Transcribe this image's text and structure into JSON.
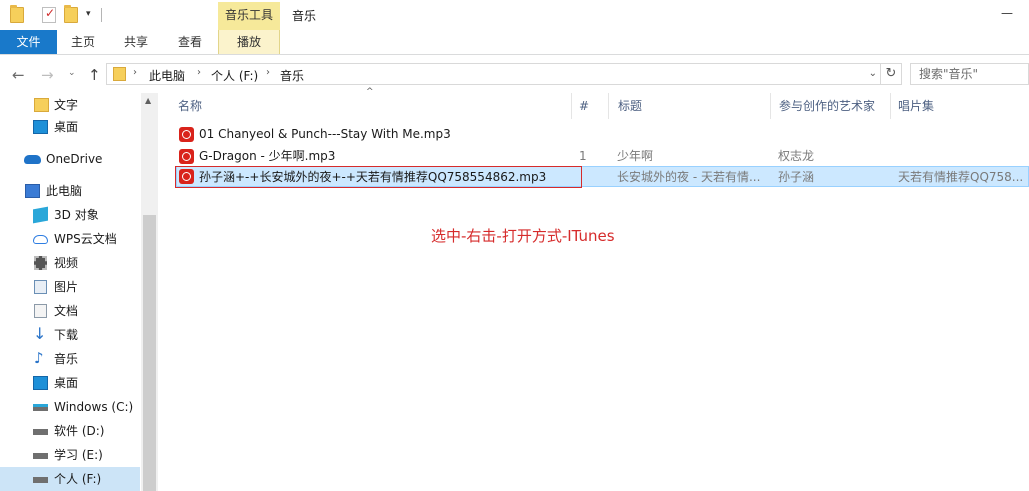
{
  "window": {
    "context_tab_group": "音乐工具",
    "title": "音乐",
    "minimize_glyph": "—"
  },
  "ribbon": {
    "tabs": [
      "文件",
      "主页",
      "共享",
      "查看",
      "播放"
    ]
  },
  "nav": {
    "back_glyph": "←",
    "forward_glyph": "→",
    "recent_glyph": "⌄",
    "up_glyph": "↑",
    "breadcrumb": [
      "此电脑",
      "个人 (F:)",
      "音乐"
    ],
    "crumb_sep": "›",
    "address_dropdown_glyph": "⌄",
    "refresh_glyph": "↻",
    "search_placeholder": "搜索\"音乐\""
  },
  "sidebar": {
    "items": [
      {
        "label": "文字",
        "icon": "folder-icon",
        "color": "#f6cf5b"
      },
      {
        "label": "桌面",
        "icon": "desktop-icon",
        "color": "#1e90d8"
      },
      {
        "label": "OneDrive",
        "icon": "onedrive-icon",
        "color": "#1f73c8"
      },
      {
        "label": "此电脑",
        "icon": "computer-icon",
        "color": "#3a7bd5"
      },
      {
        "label": "3D 对象",
        "icon": "3d-objects-icon",
        "color": "#2aa7d9"
      },
      {
        "label": "WPS云文档",
        "icon": "wps-cloud-icon",
        "color": "#2f7ee2"
      },
      {
        "label": "视频",
        "icon": "video-icon",
        "color": "#555555"
      },
      {
        "label": "图片",
        "icon": "pictures-icon",
        "color": "#6a8fb5"
      },
      {
        "label": "文档",
        "icon": "documents-icon",
        "color": "#8c9aa8"
      },
      {
        "label": "下载",
        "icon": "downloads-icon",
        "color": "#2a74c9"
      },
      {
        "label": "音乐",
        "icon": "music-icon",
        "color": "#2a74c9"
      },
      {
        "label": "桌面",
        "icon": "desktop-icon",
        "color": "#1e90d8"
      },
      {
        "label": "Windows (C:)",
        "icon": "drive-c-icon",
        "color": "#6f6f6f"
      },
      {
        "label": "软件 (D:)",
        "icon": "drive-icon",
        "color": "#6f6f6f"
      },
      {
        "label": "学习 (E:)",
        "icon": "drive-icon",
        "color": "#6f6f6f"
      },
      {
        "label": "个人 (F:)",
        "icon": "drive-icon",
        "color": "#6f6f6f",
        "selected": true
      }
    ]
  },
  "files": {
    "columns": [
      "名称",
      "#",
      "标题",
      "参与创作的艺术家",
      "唱片集"
    ],
    "sort_glyph": "^",
    "rows": [
      {
        "name": "01 Chanyeol & Punch---Stay With Me.mp3",
        "track": "",
        "title": "",
        "artist": "",
        "album": ""
      },
      {
        "name": "G-Dragon - 少年啊.mp3",
        "track": "1",
        "title": "少年啊",
        "artist": "权志龙",
        "album": ""
      },
      {
        "name": "孙子涵+-+长安城外的夜+-+天若有情推荐QQ758554862.mp3",
        "track": "",
        "title": "长安城外的夜 - 天若有情...",
        "artist": "孙子涵",
        "album": "天若有情推荐QQ758...",
        "selected": true
      }
    ]
  },
  "annotation": {
    "text": "选中-右击-打开方式-ITunes",
    "color": "#d62b2b"
  },
  "colors": {
    "file_tab": "#1979ca",
    "context_tab": "#f6e99a",
    "selection": "#cce8ff",
    "netease_icon": "#d9231b"
  }
}
